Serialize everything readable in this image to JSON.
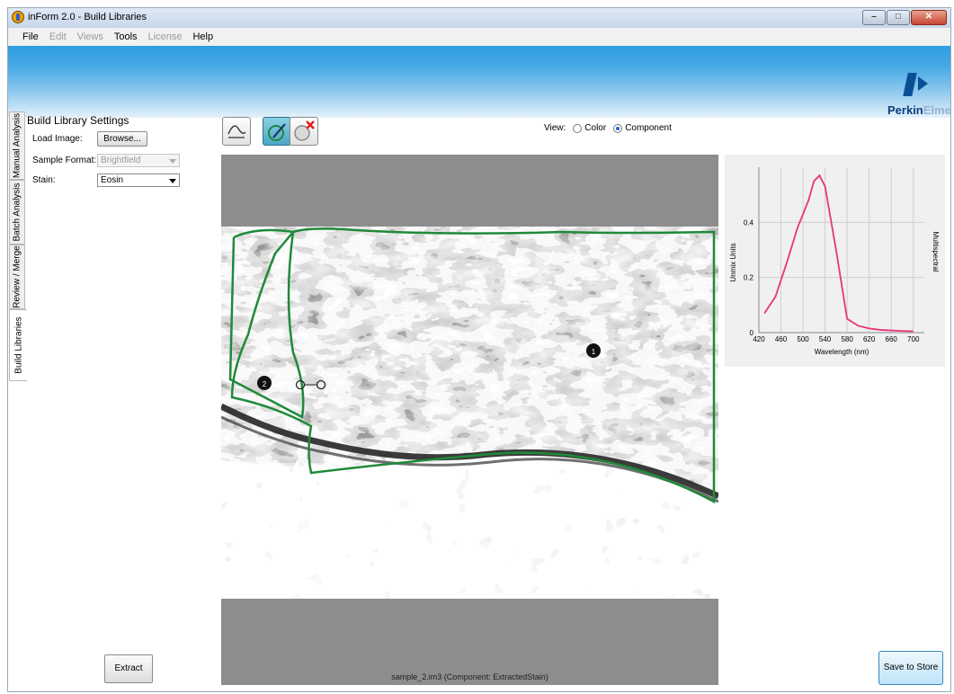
{
  "window": {
    "title": "inForm 2.0 - Build Libraries"
  },
  "menu": [
    {
      "label": "File",
      "enabled": true
    },
    {
      "label": "Edit",
      "enabled": false
    },
    {
      "label": "Views",
      "enabled": false
    },
    {
      "label": "Tools",
      "enabled": true
    },
    {
      "label": "License",
      "enabled": false
    },
    {
      "label": "Help",
      "enabled": true
    }
  ],
  "brand": {
    "name_part1": "Perkin",
    "name_part2": "Elmer"
  },
  "vertical_tabs": [
    {
      "label": "Manual Analysis"
    },
    {
      "label": "Batch Analysis"
    },
    {
      "label": "Review / Merge"
    },
    {
      "label": "Build Libraries",
      "active": true
    }
  ],
  "settings": {
    "title": "Build Library Settings",
    "load_image_label": "Load Image:",
    "browse_label": "Browse...",
    "sample_format_label": "Sample Format:",
    "sample_format_value": "Brightfield",
    "stain_label": "Stain:",
    "stain_value": "Eosin",
    "extract_label": "Extract"
  },
  "toolbar": {
    "spectrum_tool": "spectrum-curve-icon",
    "draw_tool": "draw-region-icon",
    "erase_tool": "erase-region-icon"
  },
  "view": {
    "label": "View:",
    "options": [
      {
        "label": "Color",
        "selected": false
      },
      {
        "label": "Component",
        "selected": true
      }
    ]
  },
  "image": {
    "caption": "sample_2.im3  (Component: ExtractedStain)",
    "markers": [
      "1",
      "2"
    ],
    "region_color": "#1f8a3a"
  },
  "chart_data": {
    "type": "line",
    "x": [
      430,
      450,
      470,
      490,
      510,
      520,
      530,
      540,
      560,
      580,
      600,
      620,
      640,
      660,
      680,
      700
    ],
    "series": [
      {
        "values": [
          0.07,
          0.13,
          0.25,
          0.38,
          0.48,
          0.55,
          0.57,
          0.53,
          0.3,
          0.05,
          0.025,
          0.015,
          0.01,
          0.008,
          0.006,
          0.005
        ],
        "color": "#e8337a"
      }
    ],
    "xticks": [
      420,
      460,
      500,
      540,
      580,
      620,
      660,
      700
    ],
    "yticks": [
      0,
      0.2,
      0.4
    ],
    "xlim": [
      420,
      720
    ],
    "ylim": [
      0,
      0.6
    ],
    "xlabel": "Wavelength (nm)",
    "ylabel": "Unmix Units",
    "right_label": "Multispectral",
    "grid": true
  },
  "actions": {
    "save_label": "Save to Store"
  }
}
